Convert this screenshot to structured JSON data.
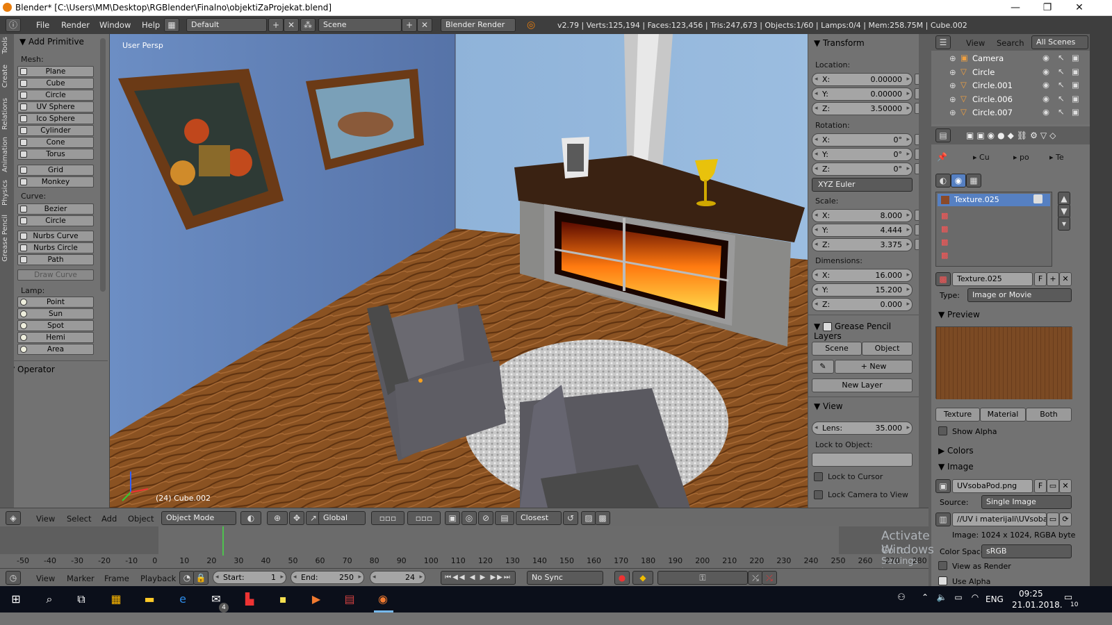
{
  "window": {
    "title": "Blender* [C:\\Users\\MM\\Desktop\\RGBlender\\Finalno\\objektiZaProjekat.blend]",
    "min": "—",
    "max": "❐",
    "close": "✕"
  },
  "menu": {
    "items": [
      "File",
      "Render",
      "Window",
      "Help"
    ],
    "layout": "Default",
    "scene": "Scene",
    "engine": "Blender Render",
    "stats": "v2.79 | Verts:125,194 | Faces:123,456 | Tris:247,673 | Objects:1/60 | Lamps:0/4 | Mem:258.75M | Cube.002"
  },
  "tool_tabs": [
    "Tools",
    "Create",
    "Relations",
    "Animation",
    "Physics",
    "Grease Pencil"
  ],
  "add_primitive": {
    "title": "Add Primitive",
    "mesh_label": "Mesh:",
    "mesh": [
      "Plane",
      "Cube",
      "Circle",
      "UV Sphere",
      "Ico Sphere",
      "Cylinder",
      "Cone",
      "Torus",
      "Grid",
      "Monkey"
    ],
    "curve_label": "Curve:",
    "curve": [
      "Bezier",
      "Circle",
      "Nurbs Curve",
      "Nurbs Circle",
      "Path"
    ],
    "draw_curve": "Draw Curve",
    "lamp_label": "Lamp:",
    "lamp": [
      "Point",
      "Sun",
      "Spot",
      "Hemi",
      "Area"
    ]
  },
  "operator": {
    "title": "Operator"
  },
  "viewport": {
    "label": "User Persp",
    "object_label": "(24) Cube.002"
  },
  "transform": {
    "title": "Transform",
    "location_label": "Location:",
    "location": [
      {
        "k": "X:",
        "v": "0.00000"
      },
      {
        "k": "Y:",
        "v": "0.00000"
      },
      {
        "k": "Z:",
        "v": "3.50000"
      }
    ],
    "rotation_label": "Rotation:",
    "rotation": [
      {
        "k": "X:",
        "v": "0°"
      },
      {
        "k": "Y:",
        "v": "0°"
      },
      {
        "k": "Z:",
        "v": "0°"
      }
    ],
    "rotation_mode": "XYZ Euler",
    "scale_label": "Scale:",
    "scale": [
      {
        "k": "X:",
        "v": "8.000"
      },
      {
        "k": "Y:",
        "v": "4.444"
      },
      {
        "k": "Z:",
        "v": "3.375"
      }
    ],
    "dimensions_label": "Dimensions:",
    "dimensions": [
      {
        "k": "X:",
        "v": "16.000"
      },
      {
        "k": "Y:",
        "v": "15.200"
      },
      {
        "k": "Z:",
        "v": "0.000"
      }
    ]
  },
  "grease": {
    "title": "Grease Pencil Layers",
    "scene": "Scene",
    "object": "Object",
    "new": "New",
    "new_layer": "New Layer"
  },
  "view": {
    "title": "View",
    "lens_k": "Lens:",
    "lens_v": "35.000",
    "lock_obj": "Lock to Object:",
    "lock_cursor": "Lock to Cursor",
    "lock_camera": "Lock Camera to View"
  },
  "outliner": {
    "menu": [
      "View",
      "Search",
      "All Scenes"
    ],
    "rows": [
      "Camera",
      "Circle",
      "Circle.001",
      "Circle.006",
      "Circle.007"
    ]
  },
  "props": {
    "crumbs": [
      "Cu",
      "po",
      "Te"
    ],
    "slot": "Texture.025",
    "tex_name": "Texture.025",
    "tex_f": "F",
    "type_label": "Type:",
    "type": "Image or Movie",
    "preview": "Preview",
    "tabs": [
      "Texture",
      "Material",
      "Both"
    ],
    "show_alpha": "Show Alpha",
    "colors": "Colors",
    "image": "Image",
    "img_name": "UVsobaPod.png",
    "source_label": "Source:",
    "source": "Single Image",
    "path": "//UV i materijali\\UVsobaP...",
    "info": "Image: 1024 x 1024, RGBA byte",
    "cs_label": "Color Space:",
    "cs": "sRGB",
    "view_render": "View as Render",
    "use_alpha": "Use Alpha"
  },
  "vp_header": {
    "menus": [
      "View",
      "Select",
      "Add",
      "Object"
    ],
    "mode": "Object Mode",
    "orient": "Global",
    "snap": "Closest"
  },
  "timeline": {
    "ticks": [
      "-50",
      "-40",
      "-30",
      "-20",
      "-10",
      "0",
      "10",
      "20",
      "30",
      "40",
      "50",
      "60",
      "70",
      "80",
      "90",
      "100",
      "110",
      "120",
      "130",
      "140",
      "150",
      "160",
      "170",
      "180",
      "190",
      "200",
      "210",
      "220",
      "230",
      "240",
      "250",
      "260",
      "270",
      "280"
    ],
    "menus": [
      "View",
      "Marker",
      "Frame",
      "Playback"
    ],
    "start_label": "Start:",
    "start": "1",
    "end_label": "End:",
    "end": "250",
    "current": "24",
    "sync": "No Sync"
  },
  "watermark": {
    "line1": "Activate Windows",
    "line2": "Go to Settings to activate Windows."
  },
  "taskbar": {
    "lang": "ENG",
    "time": "09:25",
    "date": "21.01.2018.",
    "notif": "10",
    "mail_badge": "4"
  }
}
